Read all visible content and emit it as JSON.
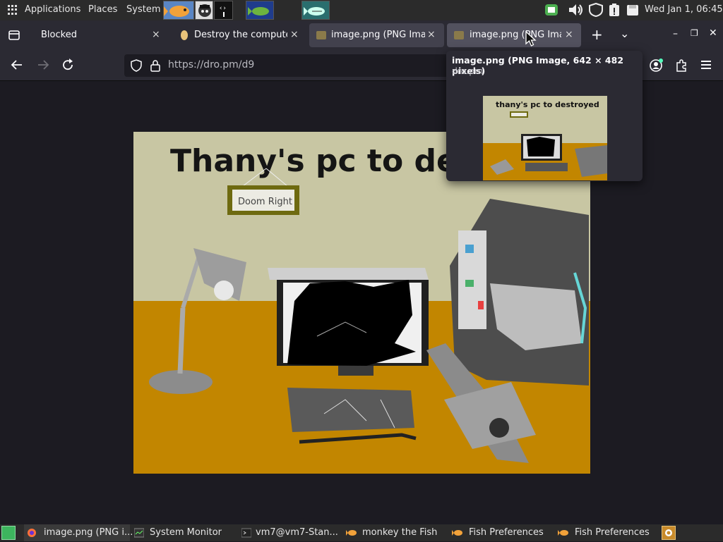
{
  "top_panel": {
    "menus": [
      "Applications",
      "Places",
      "System"
    ],
    "clock": "Wed Jan  1, 06:45"
  },
  "tabs": [
    {
      "title": "Blocked",
      "close": "×"
    },
    {
      "title": "Destroy the computer",
      "close": "×"
    },
    {
      "title": "image.png (PNG Image",
      "close": "×"
    },
    {
      "title": "image.png (PNG Imag",
      "close": "×"
    }
  ],
  "new_tab": "+",
  "tab_list": "⌄",
  "window_controls": {
    "minimize": "–",
    "restore": "❐",
    "close": "✕"
  },
  "navigation": {
    "url": "https://dro.pm/d9"
  },
  "tab_preview": {
    "title": "image.png (PNG Image, 642 × 482 pixels)",
    "domain": "dro.pm",
    "thumb_title": "thany's pc to destroyed"
  },
  "image": {
    "title": "Thany's pc to des",
    "frame_text": "Doom Right"
  },
  "taskbar": {
    "items": [
      {
        "label": "image.png (PNG i..."
      },
      {
        "label": "System Monitor"
      },
      {
        "label": "vm7@vm7-Stan..."
      },
      {
        "label": "monkey the Fish"
      },
      {
        "label": "Fish Preferences"
      },
      {
        "label": "Fish Preferences"
      }
    ]
  },
  "colors": {
    "wall": "#c8c6a3",
    "floor": "#c28600",
    "browser_bg": "#1c1b22",
    "panel": "#2b2b2b"
  }
}
